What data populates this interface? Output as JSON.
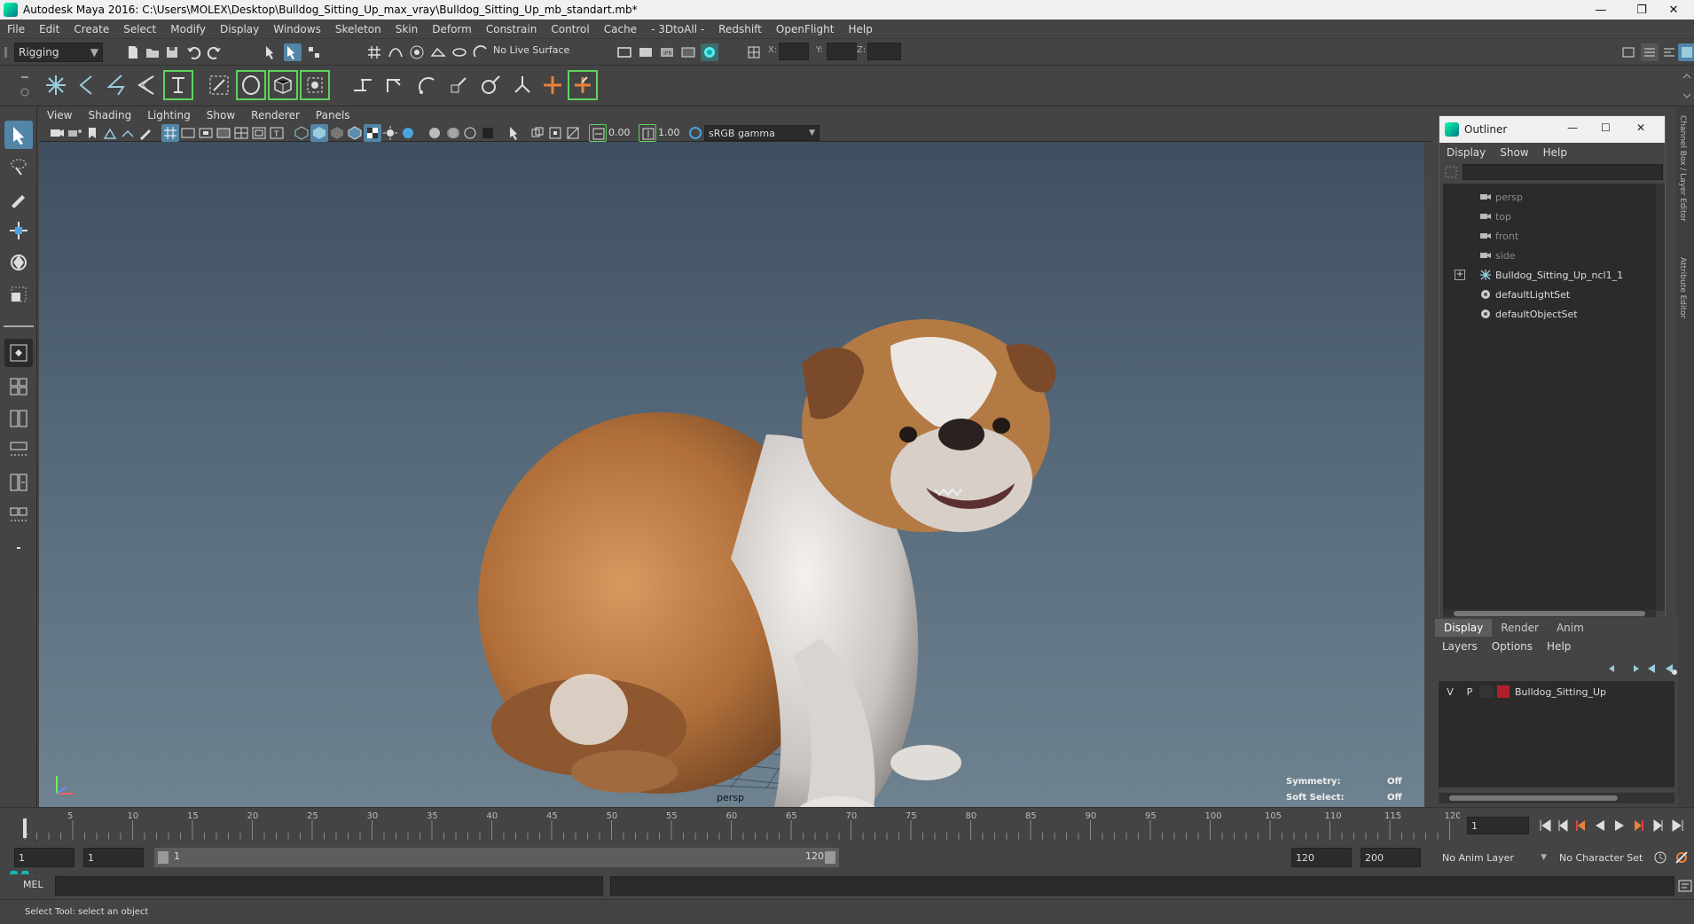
{
  "window": {
    "title": "Autodesk Maya 2016: C:\\Users\\MOLEX\\Desktop\\Bulldog_Sitting_Up_max_vray\\Bulldog_Sitting_Up_mb_standart.mb*",
    "minimize": "—",
    "restore": "❐",
    "close": "✕"
  },
  "menubar": [
    "File",
    "Edit",
    "Create",
    "Select",
    "Modify",
    "Display",
    "Windows",
    "Skeleton",
    "Skin",
    "Deform",
    "Constrain",
    "Control",
    "Cache",
    "- 3DtoAll -",
    "Redshift",
    "OpenFlight",
    "Help"
  ],
  "statusline": {
    "menuset": "Rigging",
    "live_surface": "No Live Surface",
    "x_label": "X:",
    "y_label": "Y:",
    "z_label": "Z:"
  },
  "panel": {
    "menus": [
      "View",
      "Shading",
      "Lighting",
      "Show",
      "Renderer",
      "Panels"
    ],
    "exposure": "0.00",
    "gamma": "1.00",
    "colorspace": "sRGB gamma",
    "camera_label": "persp",
    "symmetry_label": "Symmetry:",
    "symmetry_value": "Off",
    "soft_select_label": "Soft Select:",
    "soft_select_value": "Off"
  },
  "outliner": {
    "title": "Outliner",
    "menus": [
      "Display",
      "Show",
      "Help"
    ],
    "items": [
      {
        "label": "persp",
        "type": "camera",
        "dim": true
      },
      {
        "label": "top",
        "type": "camera",
        "dim": true
      },
      {
        "label": "front",
        "type": "camera",
        "dim": true
      },
      {
        "label": "side",
        "type": "camera",
        "dim": true
      },
      {
        "label": "Bulldog_Sitting_Up_ncl1_1",
        "type": "joint",
        "dim": false
      },
      {
        "label": "defaultLightSet",
        "type": "set",
        "dim": false
      },
      {
        "label": "defaultObjectSet",
        "type": "set",
        "dim": false
      }
    ],
    "channel_box_tab": "Channel Box / Layer Editor",
    "attr_editor_tab": "Attribute Editor"
  },
  "layers": {
    "tabs": [
      "Display",
      "Render",
      "Anim"
    ],
    "menus": [
      "Layers",
      "Options",
      "Help"
    ],
    "rows": [
      {
        "v": "V",
        "p": "P",
        "name": "Bulldog_Sitting_Up",
        "color": "#b0202a"
      }
    ]
  },
  "timeline": {
    "ticks": [
      "5",
      "10",
      "15",
      "20",
      "25",
      "30",
      "35",
      "40",
      "45",
      "50",
      "55",
      "60",
      "65",
      "70",
      "75",
      "80",
      "85",
      "90",
      "95",
      "100",
      "105",
      "110",
      "115",
      "120"
    ],
    "start_marker": "1",
    "current_frame": "1"
  },
  "range": {
    "start": "1",
    "playback_start": "1",
    "slider_start": "1",
    "slider_end": "120",
    "playback_end": "120",
    "end": "200",
    "anim_layer": "No Anim Layer",
    "character_set": "No Character Set"
  },
  "cmdline": {
    "label": "MEL"
  },
  "helpline": {
    "text": "Select Tool: select an object"
  },
  "colors": {
    "accent_green": "#5fd35f",
    "accent_blue": "#4aa3df",
    "highlight": "#5285a6"
  }
}
